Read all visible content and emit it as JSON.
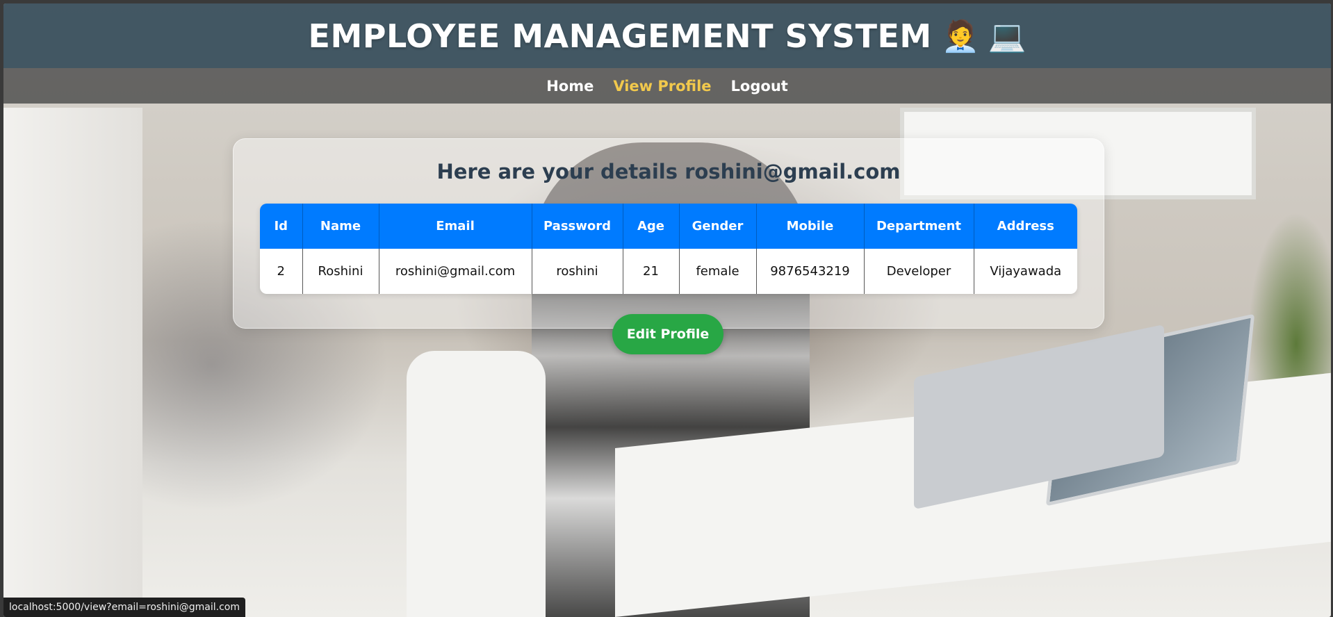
{
  "header": {
    "title": "EMPLOYEE MANAGEMENT SYSTEM",
    "emoji": "🧑‍💼 💻"
  },
  "nav": {
    "items": [
      {
        "label": "Home",
        "active": false
      },
      {
        "label": "View Profile",
        "active": true
      },
      {
        "label": "Logout",
        "active": false
      }
    ]
  },
  "profile": {
    "heading": "Here are your details roshini@gmail.com",
    "columns": [
      "Id",
      "Name",
      "Email",
      "Password",
      "Age",
      "Gender",
      "Mobile",
      "Department",
      "Address"
    ],
    "row": [
      "2",
      "Roshini",
      "roshini@gmail.com",
      "roshini",
      "21",
      "female",
      "9876543219",
      "Developer",
      "Vijayawada"
    ],
    "edit_button": "Edit Profile"
  },
  "status_bar": {
    "url": "localhost:5000/view?email=roshini@gmail.com"
  },
  "colors": {
    "header_bg": "#2e4554",
    "nav_active": "#f2c94c",
    "table_header": "#007bff",
    "edit_button": "#28a745"
  }
}
